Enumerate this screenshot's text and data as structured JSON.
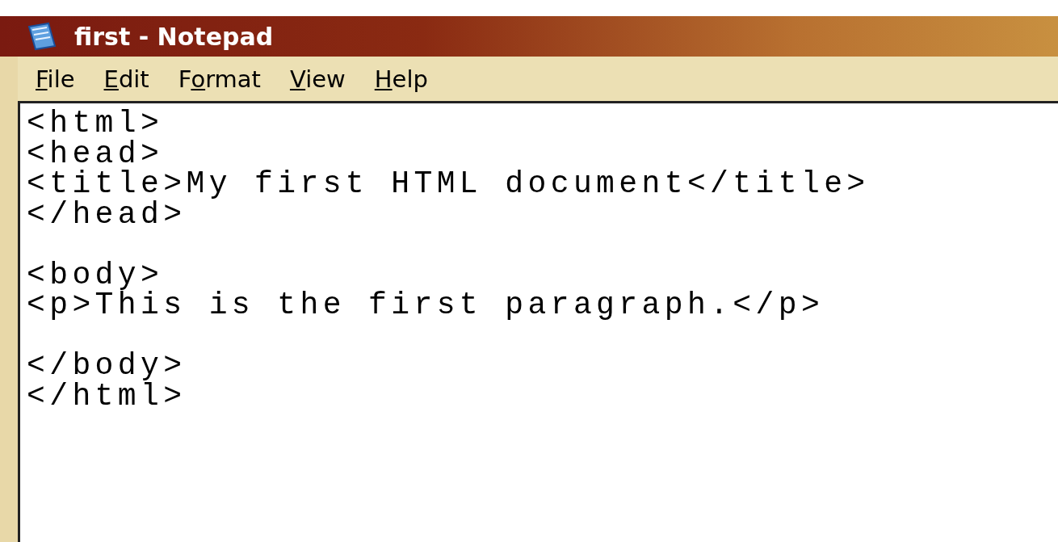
{
  "window": {
    "title": "first - Notepad"
  },
  "menu": [
    {
      "key": "F",
      "post": "ile"
    },
    {
      "key": "E",
      "post": "dit"
    },
    {
      "pre": "F",
      "key": "o",
      "post": "rmat"
    },
    {
      "key": "V",
      "post": "iew"
    },
    {
      "key": "H",
      "post": "elp"
    }
  ],
  "editor": {
    "text": "<html>\n<head>\n<title>My first HTML document</title>\n</head>\n\n<body>\n<p>This is the first paragraph.</p>\n\n</body>\n</html>"
  }
}
